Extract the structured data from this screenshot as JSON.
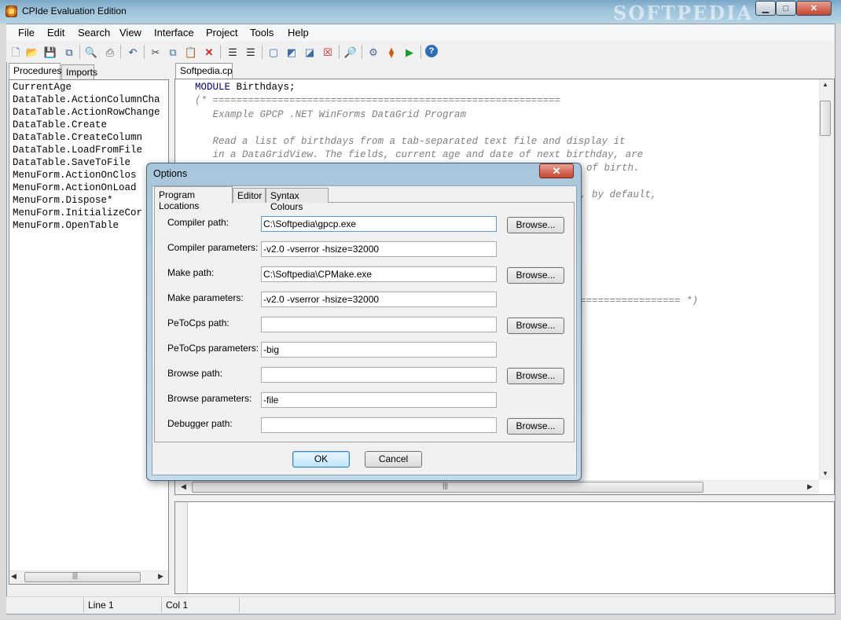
{
  "window": {
    "title": "CPIde Evaluation Edition",
    "watermark": "SOFTPEDIA"
  },
  "menu": [
    "File",
    "Edit",
    "Search",
    "View",
    "Interface",
    "Project",
    "Tools",
    "Help"
  ],
  "toolbar_icons": [
    "new-file-icon",
    "open-folder-icon",
    "save-icon",
    "save-all-icon",
    "print-preview-icon",
    "print-icon",
    "undo-icon",
    "cut-icon",
    "copy-icon",
    "paste-icon",
    "delete-icon",
    "indent-icon",
    "outdent-icon",
    "window-icon",
    "comment-icon",
    "comment-alt-icon",
    "clear-icon",
    "find-icon",
    "build-icon",
    "make-icon",
    "run-icon",
    "help-icon"
  ],
  "left_panel": {
    "tabs": [
      "Procedures",
      "Imports"
    ],
    "procedures": [
      "CurrentAge",
      "DataTable.ActionColumnCha",
      "DataTable.ActionRowChange",
      "DataTable.Create",
      "DataTable.CreateColumn",
      "DataTable.LoadFromFile",
      "DataTable.SaveToFile",
      "MenuForm.ActionOnClos",
      "MenuForm.ActionOnLoad",
      "MenuForm.Dispose*",
      "MenuForm.InitializeCor",
      "MenuForm.OpenTable"
    ]
  },
  "editor": {
    "tab": "Softpedia.cp",
    "line1_kw": "MODULE",
    "line1_rest": " Birthdays;",
    "comment_lines": [
      "(* ===========================================================",
      "   Example GPCP .NET WinForms DataGrid Program",
      "",
      "   Read a list of birthdays from a tab-separated text file and display it",
      "   in a DataGridView. The fields, current age and date of next birthday, are"
    ],
    "partial_right": [
      "of birth.",
      ", by default,"
    ],
    "end_comment": "================= *)"
  },
  "status": {
    "line": "Line 1",
    "col": "Col 1"
  },
  "dialog": {
    "title": "Options",
    "close_glyph": "✕",
    "tabs": [
      "Program Locations",
      "Editor",
      "Syntax Colours"
    ],
    "browse_label": "Browse...",
    "fields": [
      {
        "label": "Compiler path:",
        "value": "C:\\Softpedia\\gpcp.exe",
        "browse": true
      },
      {
        "label": "Compiler parameters:",
        "value": "-v2.0 -vserror -hsize=32000",
        "browse": false
      },
      {
        "label": "Make path:",
        "value": "C:\\Softpedia\\CPMake.exe",
        "browse": true
      },
      {
        "label": "Make parameters:",
        "value": "-v2.0 -vserror -hsize=32000",
        "browse": false
      },
      {
        "label": "PeToCps path:",
        "value": "",
        "browse": true
      },
      {
        "label": "PeToCps parameters:",
        "value": "-big",
        "browse": false
      },
      {
        "label": "Browse path:",
        "value": "",
        "browse": true
      },
      {
        "label": "Browse parameters:",
        "value": "-file",
        "browse": false
      },
      {
        "label": "Debugger path:",
        "value": "",
        "browse": true
      }
    ],
    "ok_label": "OK",
    "cancel_label": "Cancel"
  }
}
